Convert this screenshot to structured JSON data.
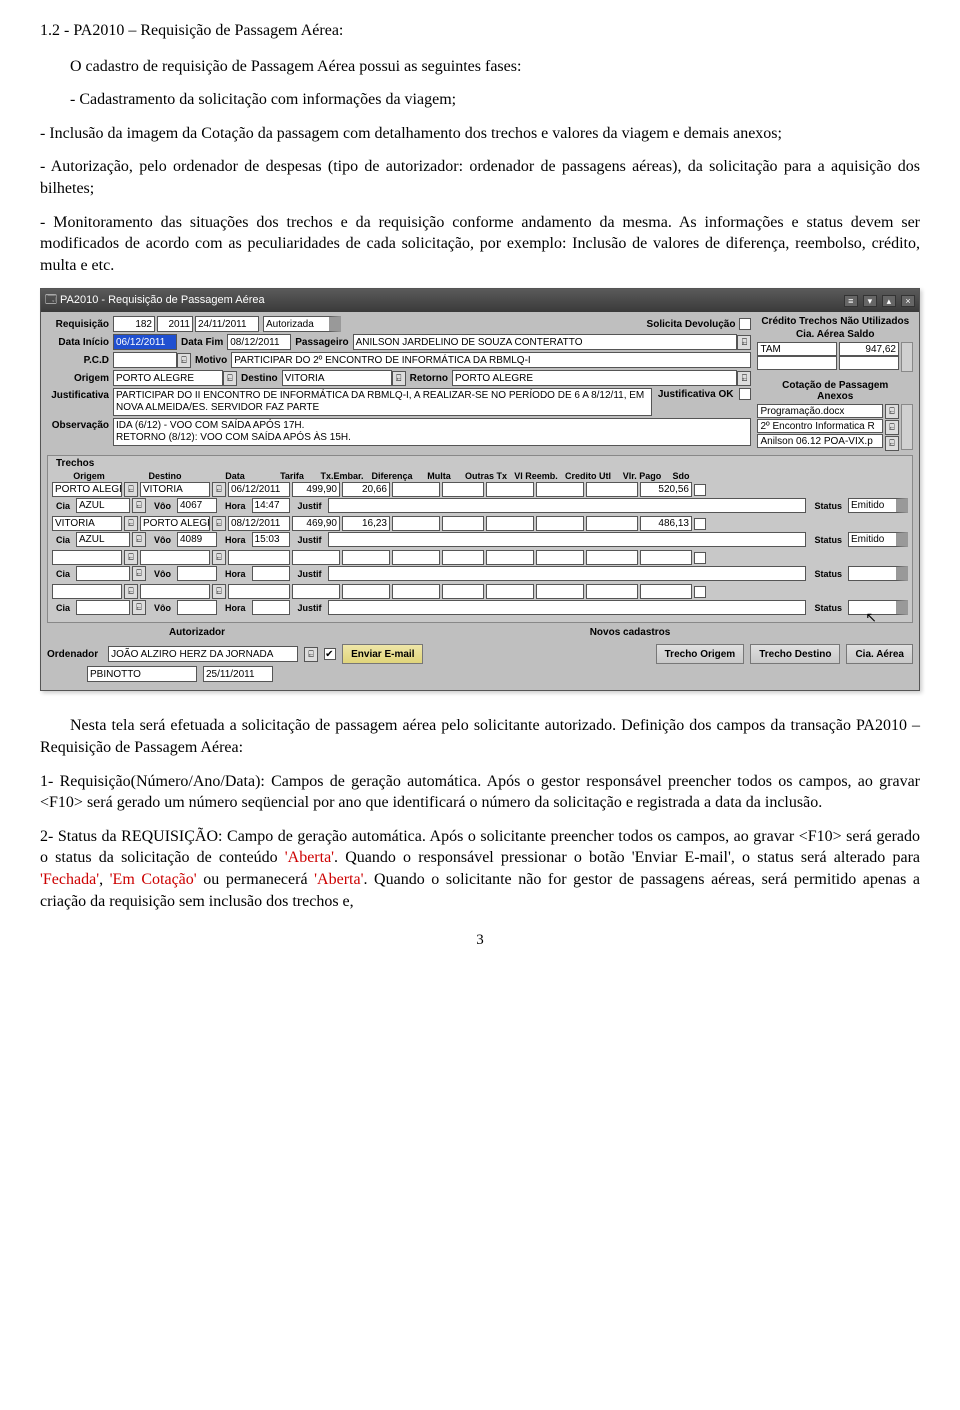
{
  "doc": {
    "heading": "1.2 - PA2010 – Requisição de Passagem Aérea:",
    "para1": "O cadastro de requisição de Passagem Aérea possui as seguintes fases:",
    "bul1": "- Cadastramento da solicitação com informações da viagem;",
    "bul2": "- Inclusão da imagem da Cotação da passagem com detalhamento dos trechos e valores da viagem e demais anexos;",
    "bul3": "- Autorização, pelo ordenador de despesas (tipo de autorizador: ordenador de passagens aéreas), da solicitação para a aquisição dos bilhetes;",
    "bul4_a": "- Monitoramento das situações dos trechos e da requisição conforme andamento da mesma. As informações e status devem ser modificados de acordo com as peculiaridades de cada solicitação, por exemplo: Inclusão de valores de diferença, reembolso, crédito, multa e etc.",
    "para_after1": "Nesta tela será efetuada a solicitação de passagem aérea pelo solicitante autorizado. Definição dos campos da transação PA2010 – Requisição de Passagem Aérea:",
    "item1": "1- Requisição(Número/Ano/Data): Campos de geração automática. Após o gestor responsável preencher todos os campos, ao gravar <F10> será gerado um número seqüencial por ano que identificará o número da solicitação e registrada a data da inclusão.",
    "item2_a": "2- Status da REQUISIÇÃO: Campo de geração automática. Após o solicitante preencher todos os campos, ao gravar <F10> será gerado o status da solicitação de conteúdo ",
    "item2_aberta": "'Aberta'",
    "item2_b": ". Quando o responsável pressionar o botão 'Enviar E-mail', o status será alterado para ",
    "item2_fechada": "'Fechada'",
    "item2_c": ", ",
    "item2_emcot": "'Em Cotação'",
    "item2_d": " ou permanecerá ",
    "item2_aberta2": "'Aberta'",
    "item2_e": ". Quando o solicitante não for gestor de passagens aéreas, será permitido apenas a criação da requisição sem inclusão dos trechos e,",
    "page_num": "3"
  },
  "win": {
    "title": "PA2010 - Requisição de Passagem Aérea",
    "labels": {
      "requisicao": "Requisição",
      "solicita_dev": "Solicita Devolução",
      "credit_hdr1": "Crédito Trechos Não Utilizados",
      "credit_hdr2": "Cia. Aérea          Saldo",
      "data_inicio": "Data Início",
      "data_fim": "Data Fim",
      "passageiro": "Passageiro",
      "pcd": "P.C.D",
      "motivo": "Motivo",
      "origem": "Origem",
      "destino": "Destino",
      "retorno": "Retorno",
      "justificativa": "Justificativa",
      "justif_ok": "Justificativa OK",
      "observacao": "Observação",
      "cotacao_hdr": "Cotação de Passagem\nAnexos",
      "trechos": "Trechos",
      "c_origem": "Origem",
      "c_destino": "Destino",
      "c_data": "Data",
      "c_tarifa": "Tarifa",
      "c_txembar": "Tx.Embar.",
      "c_dif": "Diferença",
      "c_multa": "Multa",
      "c_outras": "Outras Tx",
      "c_vlreemb": "Vl Reemb.",
      "c_credito": "Credito Utl",
      "c_vlrpago": "Vlr. Pago",
      "c_sdo": "Sdo",
      "cia": "Cia",
      "voo": "Vôo",
      "hora": "Hora",
      "justif": "Justif",
      "status": "Status",
      "autorizador": "Autorizador",
      "ordenador": "Ordenador",
      "novos_cad": "Novos cadastros",
      "enviar_email": "Enviar E-mail",
      "trecho_origem": "Trecho Origem",
      "trecho_destino": "Trecho Destino",
      "cia_aerea": "Cia. Aérea"
    },
    "vals": {
      "req_num": "182",
      "req_ano": "2011",
      "req_data": "24/11/2011",
      "req_status": "Autorizada",
      "data_inicio": "06/12/2011",
      "data_fim": "08/12/2011",
      "passageiro": "ANILSON JARDELINO DE SOUZA CONTERATTO",
      "pcd": "",
      "motivo": "PARTICIPAR DO 2º ENCONTRO DE INFORMÁTICA DA RBMLQ-I",
      "origem": "PORTO ALEGRE",
      "destino": "VITORIA",
      "retorno": "PORTO ALEGRE",
      "justificativa": "PARTICIPAR DO II ENCONTRO DE INFORMÁTICA DA RBMLQ-I, A REALIZAR-SE NO PERÍODO DE 6 A 8/12/11, EM NOVA ALMEIDA/ES. SERVIDOR FAZ PARTE",
      "observacao": "IDA (6/12) - VOO COM SAÍDA APÓS 17H.\nRETORNO (8/12): VOO COM SAÍDA APÓS ÀS 15H.",
      "credit_cia": "TAM",
      "credit_saldo": "947,62",
      "anexo1": "Programação.docx",
      "anexo2": "2º Encontro Informatica R",
      "anexo3": "Anilson 06.12 POA-VIX.p",
      "ordenador": "JOÃO ALZIRO HERZ DA JORNADA",
      "foot_user": "PBINOTTO",
      "foot_date": "25/11/2011"
    },
    "trechos": [
      {
        "origem": "PORTO ALEGR",
        "destino": "VITORIA",
        "data": "06/12/2011",
        "tarifa": "499,90",
        "txembar": "20,66",
        "dif": "",
        "multa": "",
        "outras": "",
        "vlreemb": "",
        "credito": "",
        "vlrpago": "520,56",
        "cia": "AZUL",
        "voo": "4067",
        "hora": "14:47",
        "justif": "",
        "status": "Emitido"
      },
      {
        "origem": "VITORIA",
        "destino": "PORTO ALEGR",
        "data": "08/12/2011",
        "tarifa": "469,90",
        "txembar": "16,23",
        "dif": "",
        "multa": "",
        "outras": "",
        "vlreemb": "",
        "credito": "",
        "vlrpago": "486,13",
        "cia": "AZUL",
        "voo": "4089",
        "hora": "15:03",
        "justif": "",
        "status": "Emitido"
      },
      {
        "origem": "",
        "destino": "",
        "data": "",
        "tarifa": "",
        "txembar": "",
        "dif": "",
        "multa": "",
        "outras": "",
        "vlreemb": "",
        "credito": "",
        "vlrpago": "",
        "cia": "",
        "voo": "",
        "hora": "",
        "justif": "",
        "status": ""
      },
      {
        "origem": "",
        "destino": "",
        "data": "",
        "tarifa": "",
        "txembar": "",
        "dif": "",
        "multa": "",
        "outras": "",
        "vlreemb": "",
        "credito": "",
        "vlrpago": "",
        "cia": "",
        "voo": "",
        "hora": "",
        "justif": "",
        "status": ""
      }
    ]
  }
}
